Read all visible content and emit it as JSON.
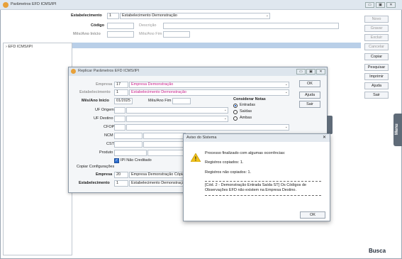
{
  "main": {
    "title": "Parâmetros EFD ICMS/IPI",
    "estabelecimento_label": "Estabelecimento",
    "estabelecimento_code": "1",
    "estabelecimento_name": "Estabelecimento Demonstração",
    "codigo_label": "Código",
    "descricao_label": "Descrição",
    "mes_ano_inicio_label": "Mês/Ano Início",
    "mes_ano_fim_label": "Mês/Ano Fim",
    "tree_item": "EFD ICMS/IPI",
    "side_buttons": [
      "Novo",
      "Gravar",
      "Excluir",
      "Cancelar",
      "Copiar",
      "Pesquisar",
      "Imprimir",
      "Ajuda",
      "Sair"
    ],
    "side_disabled": [
      true,
      true,
      true,
      true,
      false,
      false,
      false,
      false,
      false
    ],
    "menu_tab": "Menu",
    "busca_label": "Busca"
  },
  "replicar": {
    "title": "Replicar Parâmetros EFD ICMS/IPI",
    "empresa_label": "Empresa",
    "empresa_code": "17",
    "empresa_name": "Empresa Demonstração",
    "estabelecimento_label": "Estabelecimento",
    "estabelecimento_code": "1",
    "estabelecimento_name": "Estabelecimento Demonstração",
    "mes_ano_inicio_label": "Mês/Ano Início",
    "mes_ano_inicio_value": "01/2025",
    "mes_ano_fim_label": "Mês/Ano Fim",
    "uf_origem_label": "UF Origem",
    "uf_destino_label": "UF Destino",
    "cfop_label": "CFOP",
    "ncm_label": "NCM",
    "cst_label": "CST",
    "produto_label": "Produto",
    "ipi_label": "IPI Não Creditado",
    "considerar_title": "Considerar Notas",
    "radio_entradas": "Entradas",
    "radio_saidas": "Saídas",
    "radio_ambas": "Ambas",
    "copiar_label": "Copiar Configurações",
    "dest_empresa_label": "Empresa",
    "dest_empresa_code": "20",
    "dest_empresa_name": "Empresa Demonstração Cópia",
    "dest_estab_label": "Estabelecimento",
    "dest_estab_code": "1",
    "dest_estab_name": "Estabelecimento Demonstração",
    "ok_label": "OK",
    "ajuda_label": "Ajuda",
    "sair_label": "Sair"
  },
  "aviso": {
    "title": "Aviso do Sistema",
    "message": "Processo finalizado com algumas ocorrências:",
    "copiados": "Registros copiados: 1.",
    "nao_copiados": "Registros não copiados: 1.",
    "detail": "[Cód. 2 - Demonstração Entrada Saída ST] Os Códigos de Observações EFD não existem na Empresa Destino.",
    "ok_label": "OK"
  }
}
